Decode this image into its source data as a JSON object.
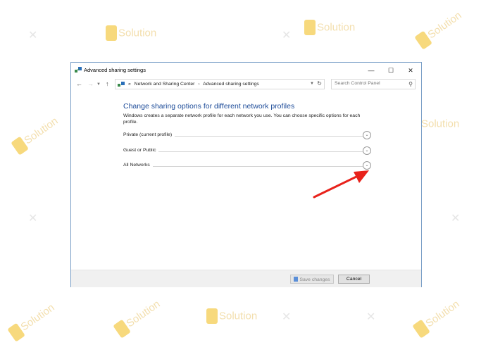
{
  "watermark": {
    "brand": "Solution"
  },
  "window": {
    "title": "Advanced sharing settings",
    "controls": {
      "minimize": "—",
      "maximize": "☐",
      "close": "✕"
    }
  },
  "addressbar": {
    "back": "←",
    "forward": "→",
    "up": "↑",
    "prefix": "«",
    "crumbs": [
      "Network and Sharing Center",
      "Advanced sharing settings"
    ],
    "separator": "›",
    "search_placeholder": "Search Control Panel"
  },
  "content": {
    "heading": "Change sharing options for different network profiles",
    "description": "Windows creates a separate network profile for each network you use. You can choose specific options for each profile.",
    "sections": [
      {
        "label": "Private (current profile)"
      },
      {
        "label": "Guest or Public"
      },
      {
        "label": "All Networks"
      }
    ]
  },
  "footer": {
    "save_label": "Save changes",
    "cancel_label": "Cancel"
  },
  "colors": {
    "heading": "#1e4c99",
    "annotation_arrow": "#e8221b",
    "window_border": "#7a9fc7"
  },
  "icons": [
    "network-icon",
    "back-arrow-icon",
    "forward-arrow-icon",
    "up-arrow-icon",
    "refresh-icon",
    "search-icon",
    "chevron-down-icon",
    "shield-icon"
  ]
}
